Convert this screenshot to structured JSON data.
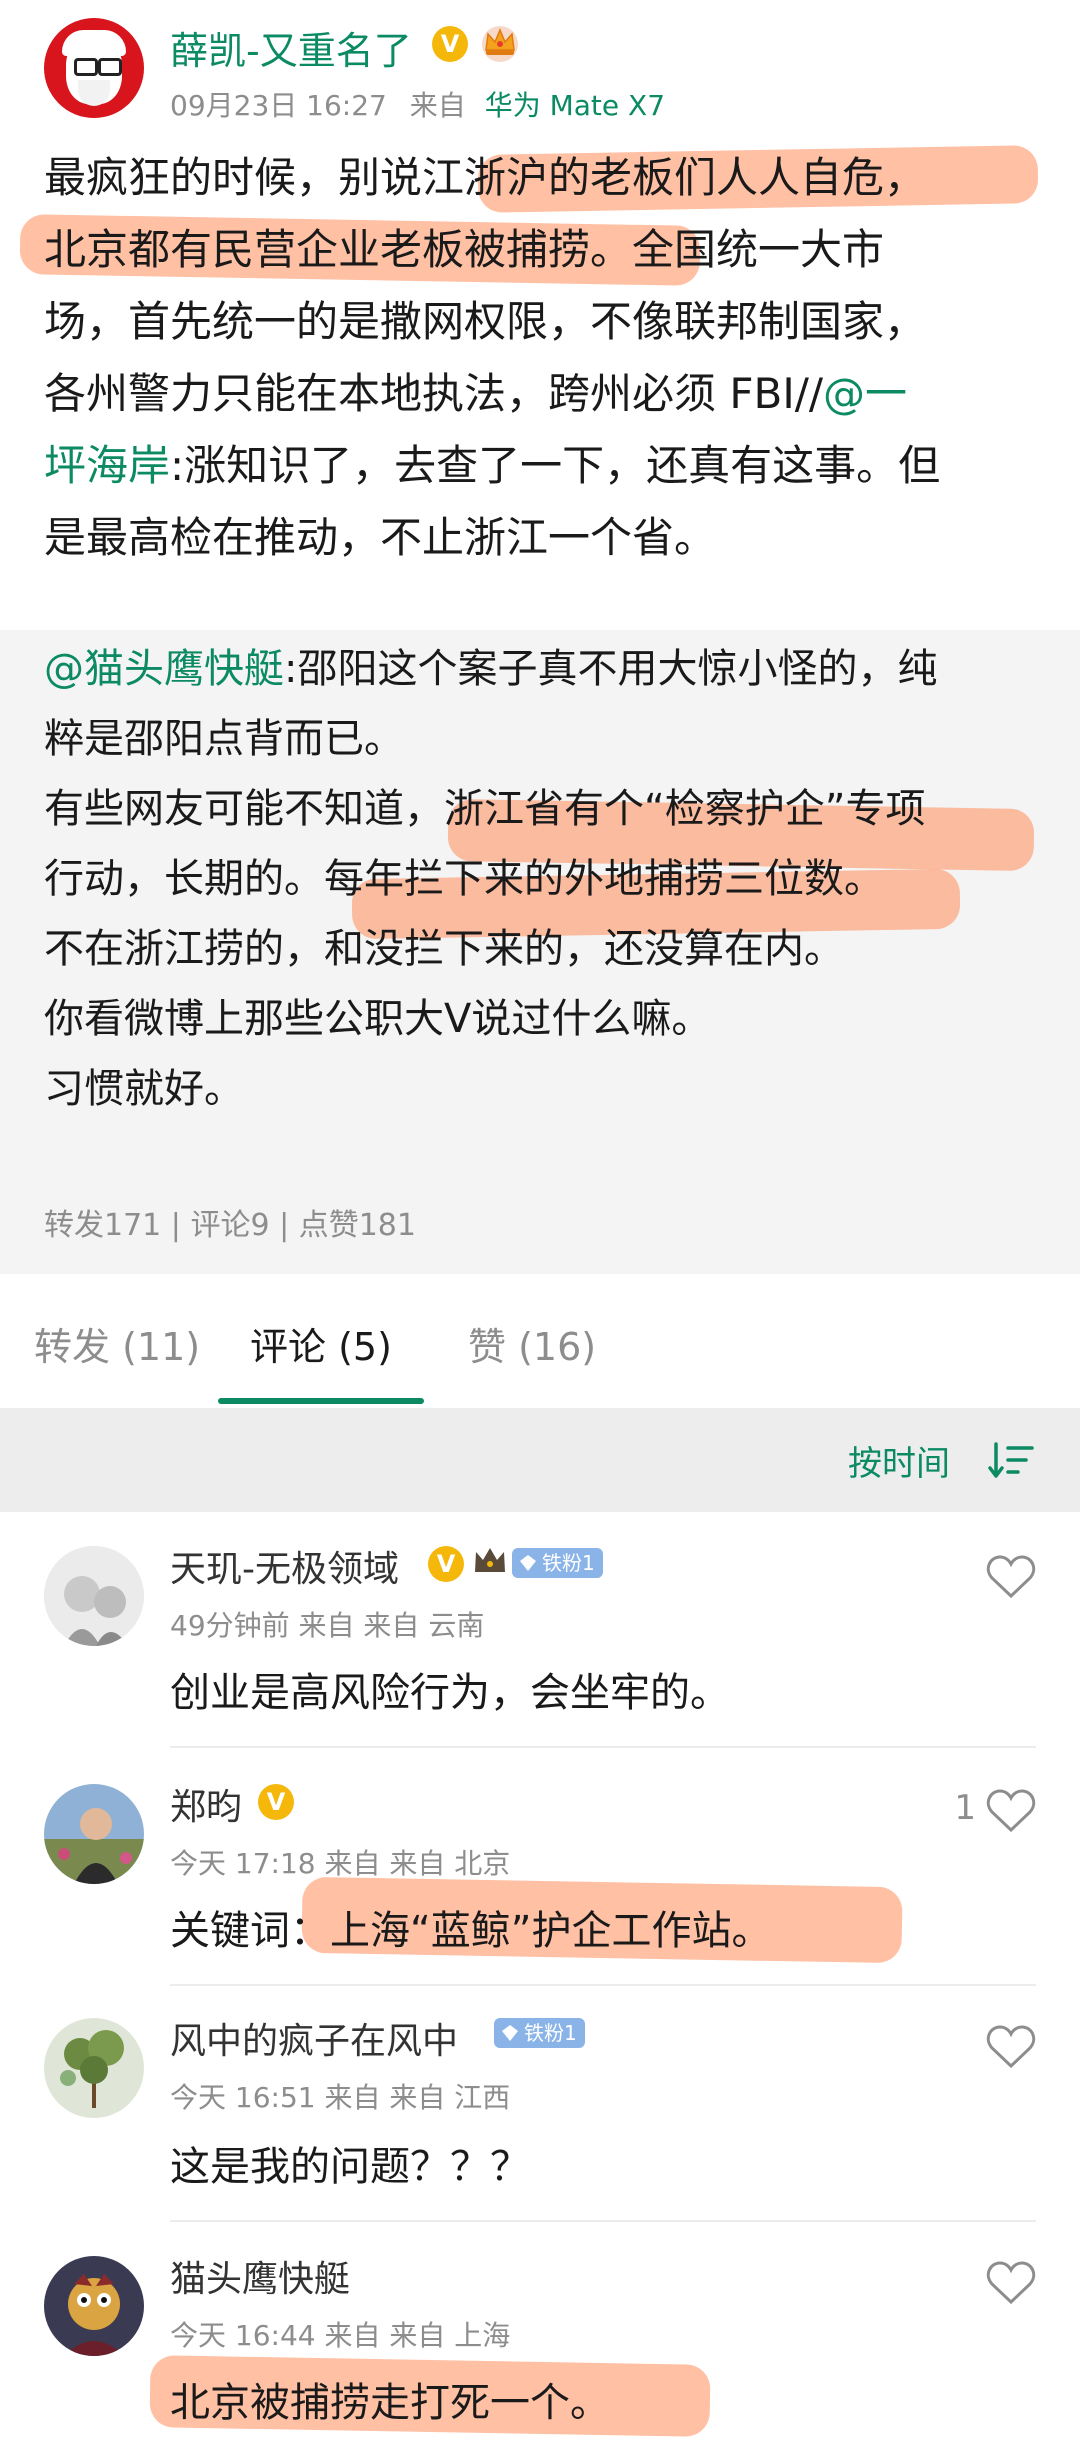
{
  "post": {
    "author": "薛凯-又重名了",
    "date": "09月23日 16:27",
    "source_prefix": "来自",
    "device": "华为 Mate X7",
    "lines": [
      "最疯狂的时候，别说江浙沪的老板们人人自危，",
      "北京都有民营企业老板被捕捞。全国统一大市",
      "场，首先统一的是撒网权限，不像联邦制国家，",
      "各州警力只能在本地执法，跨州必须 FBI//",
      "坪海岸:涨知识了，去查了一下，还真有这事。但",
      "是最高检在推动，不止浙江一个省。"
    ],
    "mention_1a": "@一",
    "mention_1b": "坪海岸"
  },
  "repost": {
    "mention": "@猫头鹰快艇",
    "lines": [
      "@猫头鹰快艇:邵阳这个案子真不用大惊小怪的，纯",
      "粹是邵阳点背而已。",
      "有些网友可能不知道，浙江省有个“检察护企”专项",
      "行动，长期的。每年拦下来的外地捕捞三位数。",
      "不在浙江捞的，和没拦下来的，还没算在内。",
      "你看微博上那些公职大V说过什么嘛。",
      "习惯就好。"
    ],
    "stats": "转发171 | 评论9 | 点赞181"
  },
  "tabs": [
    {
      "label": "转发 (11)"
    },
    {
      "label": "评论 (5)"
    },
    {
      "label": "赞 (16)"
    }
  ],
  "sort": {
    "label": "按时间"
  },
  "comments": [
    {
      "name": "天玑-无极领域",
      "badge": "铁粉1",
      "meta": "49分钟前 来自 来自 云南",
      "text": "创业是高风险行为，会坐牢的。",
      "likes": ""
    },
    {
      "name": "郑昀",
      "badge": "",
      "meta": "今天 17:18 来自 来自 北京",
      "text": "关键词：上海“蓝鲸”护企工作站。",
      "likes": "1"
    },
    {
      "name": "风中的疯子在风中",
      "badge": "铁粉1",
      "meta": "今天 16:51 来自 来自 江西",
      "text": "这是我的问题？？？",
      "likes": ""
    },
    {
      "name": "猫头鹰快艇",
      "badge": "",
      "meta": "今天 16:44 来自 来自 上海",
      "text": "北京被捕捞走打死一个。",
      "likes": ""
    }
  ],
  "colors": {
    "accent": "#0b8a63",
    "highlight": "#ff8c5a",
    "verified": "#f5b80a"
  }
}
